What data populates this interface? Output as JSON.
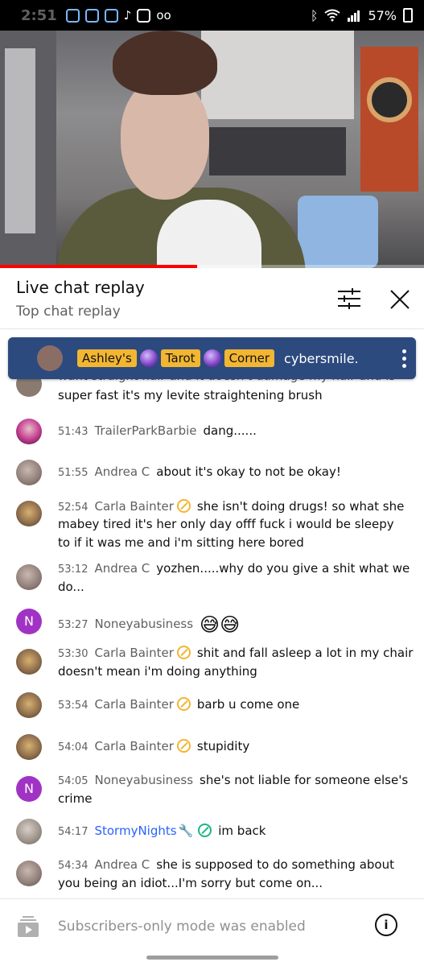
{
  "status_bar": {
    "time": "2:51",
    "tiktok_glyph": "♪",
    "voicemail_glyph": "oo",
    "bluetooth_glyph": "ᛒ",
    "battery": "57%"
  },
  "video": {
    "progress_fraction": 0.465,
    "progress_color": "#ff0000"
  },
  "header": {
    "title": "Live chat replay",
    "subtitle": "Top chat replay"
  },
  "pinned": {
    "badges": [
      "Ashley's",
      "Tarot",
      "Corner"
    ],
    "text": "cybersmile."
  },
  "messages": [
    {
      "time": "",
      "author": "",
      "line1": "want straight hair and it doesn't damage my hair and is",
      "line2": "super fast it's my levite straightening brush",
      "avatar": "photo",
      "avatar_color": "#8a7a70"
    },
    {
      "time": "51:43",
      "author": "TrailerParkBarbie",
      "text": "dang......",
      "avatar": "photo",
      "avatar_color": "#c23a8f"
    },
    {
      "time": "51:55",
      "author": "Andrea C",
      "text": "about it's okay to not be okay!",
      "avatar": "photo",
      "avatar_color": "#8f7d78"
    },
    {
      "time": "52:54",
      "author": "Carla Bainter",
      "verified": true,
      "text": "she isn't doing drugs! so what she",
      "line2": "mabey tired it's her only day offf fuck i would be sleepy",
      "line3": "to if it was me and i'm sitting here bored",
      "avatar": "photo",
      "avatar_color": "#8a6a4a"
    },
    {
      "time": "53:12",
      "author": "Andrea C",
      "text": "yozhen.....why do you give a shit what we",
      "line2": "do...",
      "avatar": "photo",
      "avatar_color": "#8f7d78"
    },
    {
      "time": "53:27",
      "author": "Noneyabusiness",
      "text": "😅😅",
      "avatar": "letter",
      "avatar_letter": "N",
      "avatar_color": "#a133c4"
    },
    {
      "time": "53:30",
      "author": "Carla Bainter",
      "verified": true,
      "text": "shit and fall asleep a lot in my chair",
      "line2": "doesn't mean i'm doing anything",
      "avatar": "photo",
      "avatar_color": "#8a6a4a"
    },
    {
      "time": "53:54",
      "author": "Carla Bainter",
      "verified": true,
      "text": "barb u come one",
      "avatar": "photo",
      "avatar_color": "#8a6a4a"
    },
    {
      "time": "54:04",
      "author": "Carla Bainter",
      "verified": true,
      "text": "stupidity",
      "avatar": "photo",
      "avatar_color": "#8a6a4a"
    },
    {
      "time": "54:05",
      "author": "Noneyabusiness",
      "text": "she's not liable for someone else's",
      "line2": "crime",
      "avatar": "letter",
      "avatar_letter": "N",
      "avatar_color": "#a133c4"
    },
    {
      "time": "54:17",
      "author": "StormyNights",
      "moderator": true,
      "text": "im back",
      "avatar": "photo",
      "avatar_color": "#9a9088"
    },
    {
      "time": "54:34",
      "author": "Andrea C",
      "text": "she is supposed to do something about",
      "line2": "you being an idiot...I'm sorry but come on...",
      "avatar": "photo",
      "avatar_color": "#8f7d78"
    }
  ],
  "footer": {
    "text": "Subscribers-only mode was enabled",
    "info_glyph": "i"
  },
  "colors": {
    "pinned_bg": "#2c4a7e",
    "badge_gold": "#f2b632",
    "moderator_blue": "#2962ff",
    "secondary_text": "#606060"
  }
}
